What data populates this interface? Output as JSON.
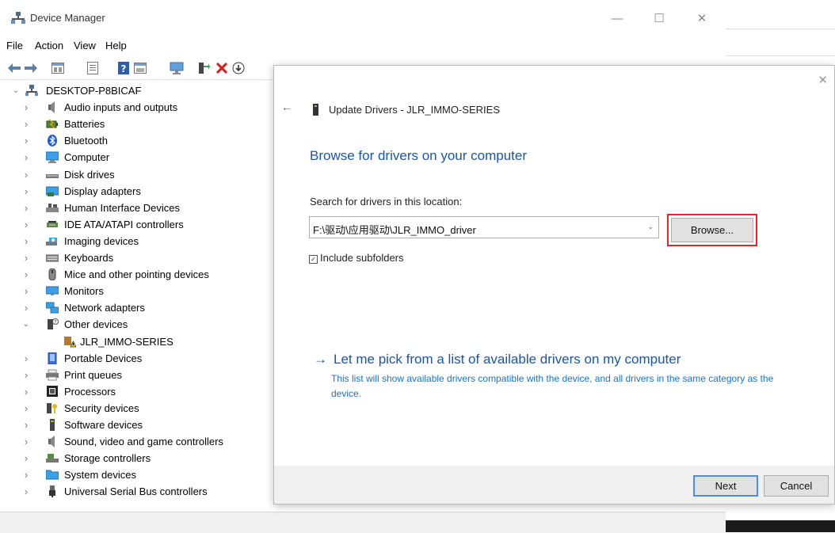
{
  "window": {
    "title": "Device Manager",
    "minimize": "—",
    "maximize": "☐",
    "close": "✕"
  },
  "menu": [
    "File",
    "Action",
    "View",
    "Help"
  ],
  "tree": {
    "root": "DESKTOP-P8BICAF",
    "items": [
      {
        "label": "Audio inputs and outputs",
        "icon": "speaker-icon"
      },
      {
        "label": "Batteries",
        "icon": "battery-icon"
      },
      {
        "label": "Bluetooth",
        "icon": "bluetooth-icon"
      },
      {
        "label": "Computer",
        "icon": "computer-icon"
      },
      {
        "label": "Disk drives",
        "icon": "disk-drive-icon"
      },
      {
        "label": "Display adapters",
        "icon": "display-adapter-icon"
      },
      {
        "label": "Human Interface Devices",
        "icon": "hid-icon"
      },
      {
        "label": "IDE ATA/ATAPI controllers",
        "icon": "ide-controller-icon"
      },
      {
        "label": "Imaging devices",
        "icon": "camera-icon"
      },
      {
        "label": "Keyboards",
        "icon": "keyboard-icon"
      },
      {
        "label": "Mice and other pointing devices",
        "icon": "mouse-icon"
      },
      {
        "label": "Monitors",
        "icon": "monitor-icon"
      },
      {
        "label": "Network adapters",
        "icon": "network-icon"
      },
      {
        "label": "Other devices",
        "icon": "unknown-device-icon",
        "expanded": true
      },
      {
        "label": "JLR_IMMO-SERIES",
        "icon": "warning-device-icon",
        "child": true
      },
      {
        "label": "Portable Devices",
        "icon": "portable-device-icon"
      },
      {
        "label": "Print queues",
        "icon": "printer-icon"
      },
      {
        "label": "Processors",
        "icon": "processor-icon"
      },
      {
        "label": "Security devices",
        "icon": "security-icon"
      },
      {
        "label": "Software devices",
        "icon": "software-device-icon"
      },
      {
        "label": "Sound, video and game controllers",
        "icon": "speaker-icon"
      },
      {
        "label": "Storage controllers",
        "icon": "storage-icon"
      },
      {
        "label": "System devices",
        "icon": "folder-icon"
      },
      {
        "label": "Universal Serial Bus controllers",
        "icon": "usb-icon"
      }
    ]
  },
  "dialog": {
    "back": "←",
    "close": "✕",
    "title": "Update Drivers - JLR_IMMO-SERIES",
    "heading": "Browse for drivers on your computer",
    "search_label": "Search for drivers in this location:",
    "path_value": "F:\\驱动\\应用驱动\\JLR_IMMO_driver",
    "browse_label": "Browse...",
    "include_subfolders": "Include subfolders",
    "pick_arrow": "→",
    "pick_link": "Let me pick from a list of available drivers on my computer",
    "pick_desc": "This list will show available drivers compatible with the device, and all drivers in the same category as the device.",
    "next_label": "Next",
    "cancel_label": "Cancel"
  },
  "colors": {
    "accent": "#1a56a8",
    "link": "#1a73c8",
    "highlight": "#e2262b"
  }
}
